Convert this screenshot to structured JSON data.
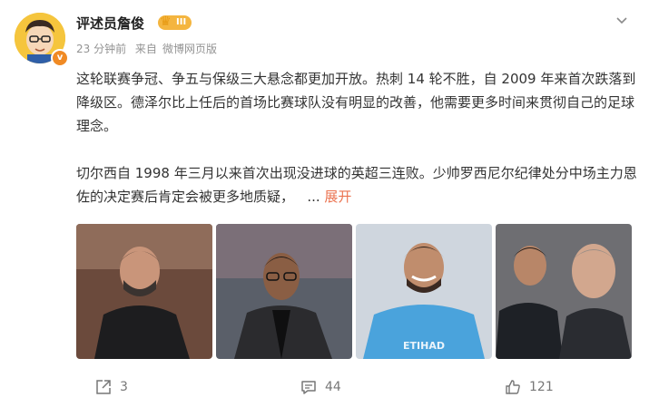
{
  "post": {
    "author": "评述员詹俊",
    "rank_label": "III",
    "meta": {
      "time": "23 分钟前",
      "source_prefix": "来自",
      "source": "微博网页版"
    },
    "paragraph1": "这轮联赛争冠、争五与保级三大悬念都更加开放。热刺 14 轮不胜，自 2009 年来首次跌落到降级区。德泽尔比上任后的首场比赛球队没有明显的改善，他需要更多时间来贯彻自己的足球理念。",
    "paragraph2": "切尔西自 1998 年三月以来首次出现没进球的英超三连败。少帅罗西尼尔纪律处分中场主力恩佐的决定赛后肯定会被更多地质疑，",
    "ellipsis": "...",
    "expand": "展开",
    "photo_caption_text": "ETIHAD"
  },
  "actions": {
    "share_count": "3",
    "comment_count": "44",
    "like_count": "121"
  },
  "colors": {
    "accent": "#eb7350",
    "meta": "#939393",
    "badge": "#f4b53f"
  }
}
